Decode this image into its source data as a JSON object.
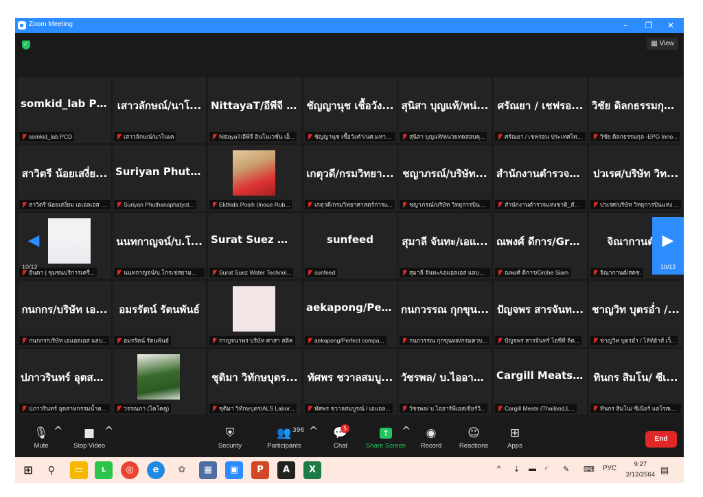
{
  "window": {
    "title": "Zoom Meeting",
    "minimize": "–",
    "restore": "❐",
    "close": "✕"
  },
  "topbar": {
    "view_label": "View",
    "view_icon": "▦"
  },
  "tiles": [
    {
      "big": "somkid_lab PCD",
      "cap": "somkid_lab PCD"
    },
    {
      "big": "เสาวลักษณ์/นาโ...",
      "cap": "เสาวลักษณ์/นาโนเค"
    },
    {
      "big": "NittayaT/อีพีจี อิ...",
      "cap": "NittayaT/อีพีจี อินโนเวชั่น เอ็..."
    },
    {
      "big": "ชัญญานุช เชื้อวัง...",
      "cap": "ชัญญานุช เชื้อวังคำ/นศ.มหาวิ..."
    },
    {
      "big": "สุนิสา บุญแท้/หน่...",
      "cap": "สุนิสา บุญแท้/หน่วยทดสอบคุ..."
    },
    {
      "big": "ศรัณยา / เชฟรอ...",
      "cap": "ศรัณยา / เชฟรอน ประเทศไทย..."
    },
    {
      "big": "วิชัย ดิลกธรรมกุล...",
      "cap": "วิชัย ดิลกธรรมกุล -EPG Inno..."
    },
    {
      "big": "สาวิตรี น้อยเสงี่ย...",
      "cap": "สาวิตรี น้อยเสงี่ยม เอเอลเอส แ..."
    },
    {
      "big": "Suriyan Phutha...",
      "cap": "Suriyan Phuthanaphatyot..."
    },
    {
      "big": "",
      "cap": "Ekthida Posih (Inoue Rub..."
    },
    {
      "big": "เกตุวดี/กรมวิทยา...",
      "cap": "เกตุวดี/กรมวิทยาศาสตร์การแ..."
    },
    {
      "big": "ชญาภรณ์/บริษัท...",
      "cap": "ชญาภรณ์/บริษัท วิทยุการบินแ..."
    },
    {
      "big": "สำนักงานตำรวจแ...",
      "cap": "สำนักงานตำรวจแห่งชาติ_สัมฯ..."
    },
    {
      "big": "ปวเรศ/บริษัท วิท...",
      "cap": "ปวเรศ/บริษัท วิทยุการบินแห่งป..."
    },
    {
      "big": "",
      "cap": "อันดา | ชุมชนบริการเครื..."
    },
    {
      "big": "นนทกาญจน์/บ.โ...",
      "cap": "นนทกาญจน์/บ.โกรเช่สยามจำ..."
    },
    {
      "big": "Surat Suez Wat...",
      "cap": "Surat Suez Water Technol..."
    },
    {
      "big": "sunfeed",
      "cap": "sunfeed"
    },
    {
      "big": "สุมาลี จันทะ/เอแ...",
      "cap": "สุมาลี จันทะ/เอแอลเอส แลบอร..."
    },
    {
      "big": "ณพงศ์ ดีการ/Gro...",
      "cap": "ณพงศ์ ดีการ/Grohe Siam"
    },
    {
      "big": "จิณากานต์/ส",
      "cap": "จิณากานต์/สดช."
    },
    {
      "big": "กนกกร/บริษัท เอ...",
      "cap": "กนกกร/บริษัท เอแอลเอส แลบ..."
    },
    {
      "big": "อมรรัตน์ รัตนพันธ์",
      "cap": "อมรรัตน์ รัตนพันธ์"
    },
    {
      "big": "",
      "cap": "กาญจนาพร บริษัท ศาสา สติค"
    },
    {
      "big": "aekapong/Perf...",
      "cap": "aekapong/Perfect compa..."
    },
    {
      "big": "กนกวรรณ กุกขุน...",
      "cap": "กนกวรรณ กุกขุนทด/กรมควบ..."
    },
    {
      "big": "ปัญจพร สารจันท...",
      "cap": "ปัญจพร สารจันทร์ ไอซีที ลิต..."
    },
    {
      "big": "ชาญวิท บุตรอ่ำ /...",
      "cap": "ชาญวิท บุตรอ่ำ / ไล้ท์ฮ้าส์ เว็..."
    },
    {
      "big": "ปภาวรินทร์ อุตสา...",
      "cap": "ปภาวรินทร์ อุตสาหกรรมน้ำตา..."
    },
    {
      "big": "",
      "cap": "วรรณภา (โคโคตู)"
    },
    {
      "big": "ชุติมา วิทักษบุตร...",
      "cap": "ชุติมา วิทักษบุตร/ALS Labor..."
    },
    {
      "big": "ทัศพร ชวาลสมบู...",
      "cap": "ทัศพร ชวาลสมบูรณ์ / เอแอล..."
    },
    {
      "big": "วัชรพล/ บ.ไออาร์...",
      "cap": "วัชรพล/ บ.ไออาร์พีเอสเซียร์วิ..."
    },
    {
      "big": "Cargill Meats (T...",
      "cap": "Cargill Meats (Thailand,L..."
    },
    {
      "big": "ทินกร สิมโน/ ซีเ...",
      "cap": "ทินกร สิมโน/ ซีเนียร์ แอโรสเป..."
    }
  ],
  "nav": {
    "prev_page": "10/12",
    "next_page": "10/12",
    "prev_icon": "◀",
    "next_icon": "▶"
  },
  "toolbar": {
    "mute": "Mute",
    "stop_video": "Stop Video",
    "security": "Security",
    "participants": "Participants",
    "participants_count": "396",
    "chat": "Chat",
    "chat_badge": "5",
    "share_screen": "Share Screen",
    "record": "Record",
    "reactions": "Reactions",
    "apps": "Apps",
    "end": "End"
  },
  "taskbar": {
    "tray_lang": "РУС",
    "time": "9:27",
    "date": "2/12/2564"
  },
  "colors": {
    "accent": "#2d8cff",
    "end": "#e02828",
    "share": "#23c55e",
    "tile": "#232323"
  }
}
